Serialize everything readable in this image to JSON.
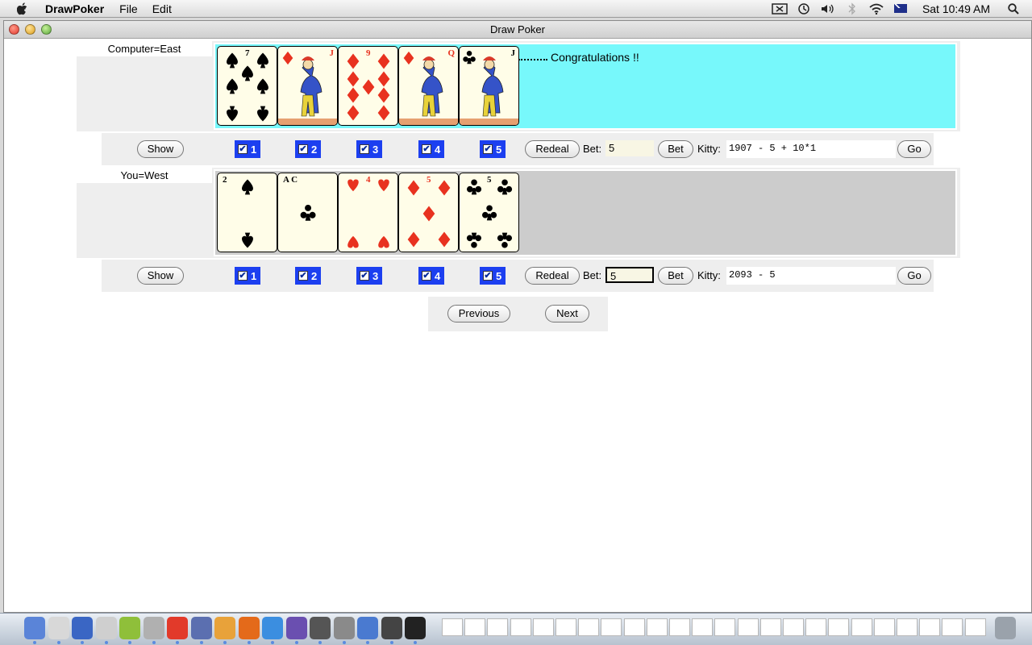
{
  "menubar": {
    "app_name": "DrawPoker",
    "menus": [
      "File",
      "Edit"
    ],
    "clock": "Sat 10:49 AM"
  },
  "window": {
    "title": "Draw Poker"
  },
  "computer": {
    "label": "Computer=East",
    "message": "Congratulations !!",
    "hand_background": "#77f8fb",
    "cards": [
      {
        "rank": "7",
        "suit": "spades"
      },
      {
        "rank": "J",
        "suit": "diamonds"
      },
      {
        "rank": "9",
        "suit": "diamonds"
      },
      {
        "rank": "Q",
        "suit": "diamonds"
      },
      {
        "rank": "J",
        "suit": "clubs"
      }
    ],
    "show_label": "Show",
    "holds": [
      "1",
      "2",
      "3",
      "4",
      "5"
    ],
    "redeal_label": "Redeal",
    "bet_label": "Bet:",
    "bet_value": "5",
    "bet_button": "Bet",
    "kitty_label": "Kitty:",
    "kitty_value": "1907 - 5 + 10*1",
    "go_label": "Go"
  },
  "player": {
    "label": "You=West",
    "hand_background": "#cccccc",
    "cards": [
      {
        "rank": "2",
        "suit": "spades"
      },
      {
        "rank": "A",
        "suit": "clubs"
      },
      {
        "rank": "4",
        "suit": "hearts"
      },
      {
        "rank": "5",
        "suit": "diamonds"
      },
      {
        "rank": "5",
        "suit": "clubs"
      }
    ],
    "show_label": "Show",
    "holds": [
      "1",
      "2",
      "3",
      "4",
      "5"
    ],
    "redeal_label": "Redeal",
    "bet_label": "Bet:",
    "bet_value": "5",
    "bet_button": "Bet",
    "kitty_label": "Kitty:",
    "kitty_value": "2093 - 5",
    "go_label": "Go"
  },
  "nav": {
    "previous_label": "Previous",
    "next_label": "Next"
  },
  "colors": {
    "hold_checkbox": "#1c3ff0",
    "red_suit": "#e8321f"
  }
}
